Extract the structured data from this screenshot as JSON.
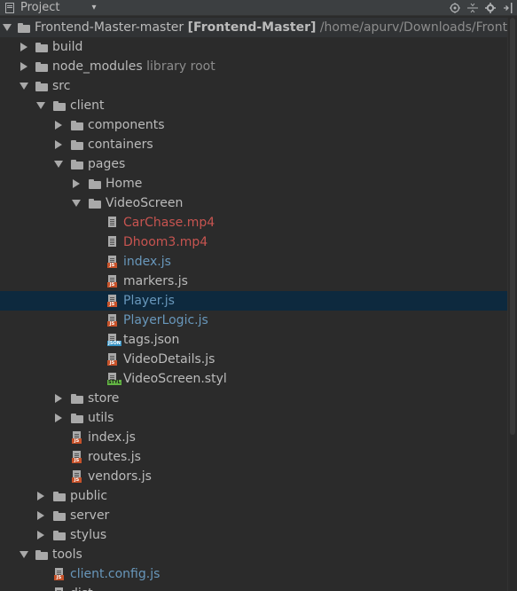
{
  "toolbar": {
    "title": "Project",
    "dropdown": "▾",
    "icons": [
      "target-icon",
      "collapse-all-icon",
      "gear-icon",
      "hide-icon"
    ]
  },
  "tree": {
    "root": {
      "name": "Frontend-Master-master",
      "module": "[Frontend-Master]",
      "path": "/home/apurv/Downloads/Fronte"
    },
    "rows": [
      {
        "label": "build",
        "extra": ""
      },
      {
        "label": "node_modules",
        "extra": "library root"
      },
      {
        "label": "src",
        "extra": ""
      },
      {
        "label": "client",
        "extra": ""
      },
      {
        "label": "components",
        "extra": ""
      },
      {
        "label": "containers",
        "extra": ""
      },
      {
        "label": "pages",
        "extra": ""
      },
      {
        "label": "Home",
        "extra": ""
      },
      {
        "label": "VideoScreen",
        "extra": ""
      },
      {
        "label": "CarChase.mp4",
        "extra": ""
      },
      {
        "label": "Dhoom3.mp4",
        "extra": ""
      },
      {
        "label": "index.js",
        "extra": ""
      },
      {
        "label": "markers.js",
        "extra": ""
      },
      {
        "label": "Player.js",
        "extra": ""
      },
      {
        "label": "PlayerLogic.js",
        "extra": ""
      },
      {
        "label": "tags.json",
        "extra": ""
      },
      {
        "label": "VideoDetails.js",
        "extra": ""
      },
      {
        "label": "VideoScreen.styl",
        "extra": ""
      },
      {
        "label": "store",
        "extra": ""
      },
      {
        "label": "utils",
        "extra": ""
      },
      {
        "label": "index.js",
        "extra": ""
      },
      {
        "label": "routes.js",
        "extra": ""
      },
      {
        "label": "vendors.js",
        "extra": ""
      },
      {
        "label": "public",
        "extra": ""
      },
      {
        "label": "server",
        "extra": ""
      },
      {
        "label": "stylus",
        "extra": ""
      },
      {
        "label": "tools",
        "extra": ""
      },
      {
        "label": "client.config.js",
        "extra": ""
      },
      {
        "label": "dist",
        "extra": ""
      }
    ],
    "file_tags": {
      "js": "JS",
      "json": "JSON",
      "styl": "STYL"
    }
  },
  "colors": {
    "background": "#2b2b2b",
    "selection": "#0d293e",
    "modified_blue": "#6897bb",
    "unversioned_red": "#c75450",
    "text": "#bbbbbb"
  }
}
